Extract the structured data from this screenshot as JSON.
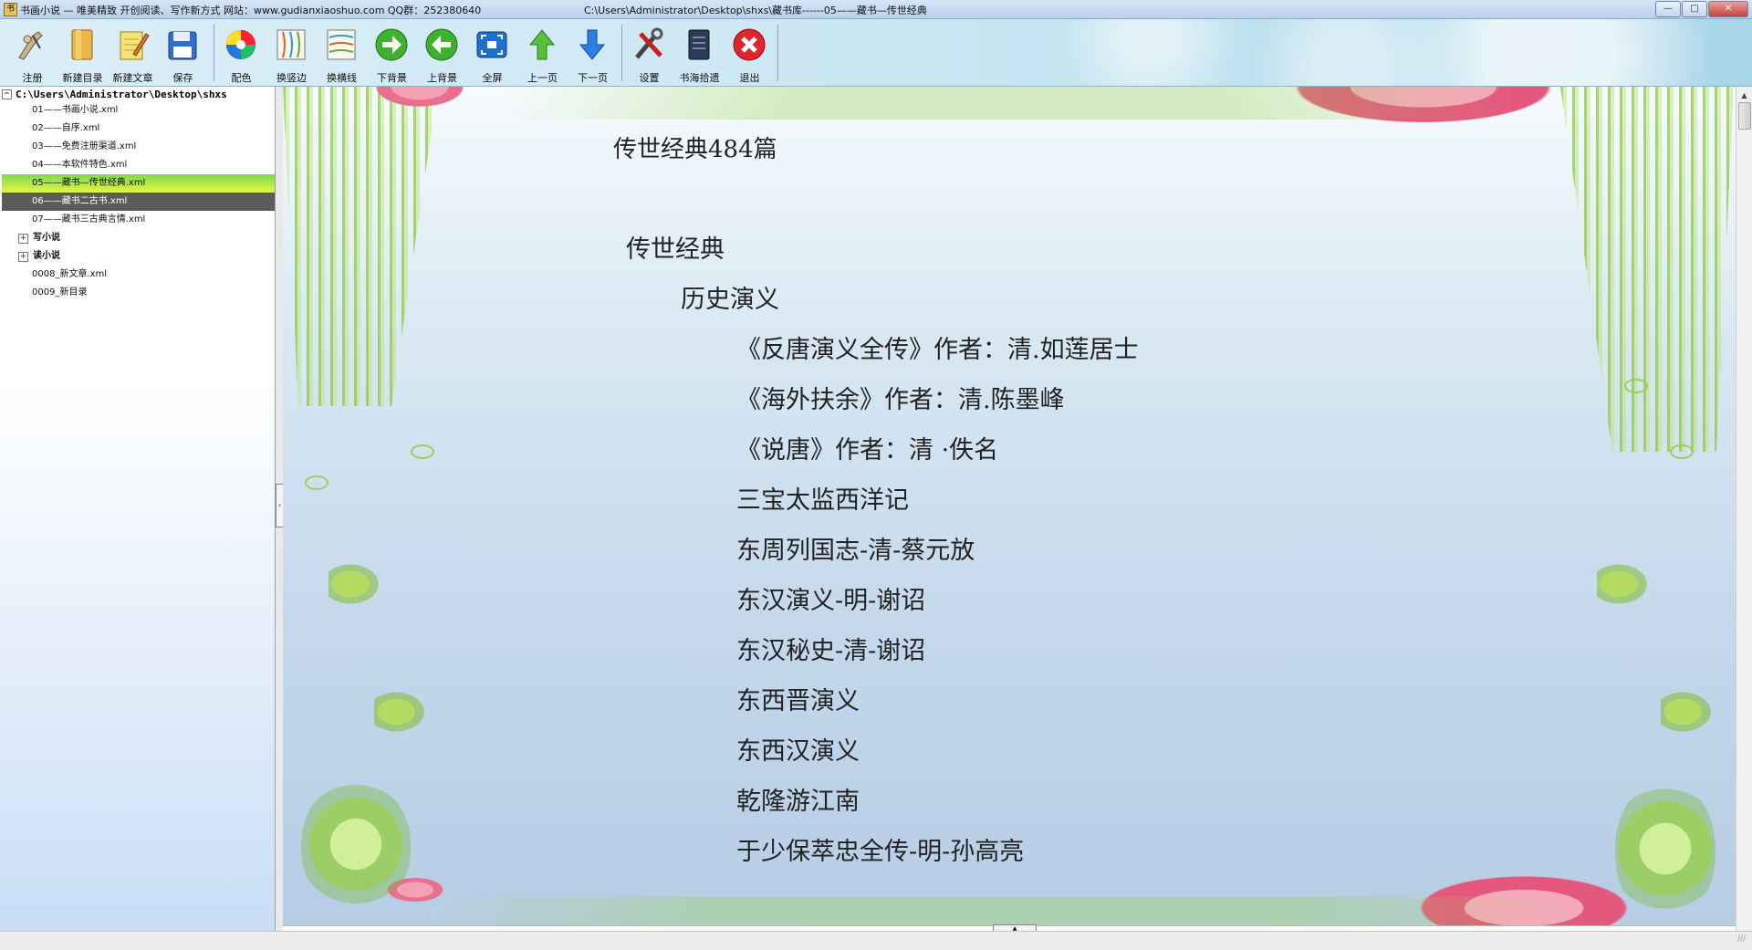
{
  "window": {
    "title": "书画小说 — 唯美精致 开创阅读、写作新方式 网站：www.gudianxiaoshuo.com QQ群：252380640",
    "path": "C:\\Users\\Administrator\\Desktop\\shxs\\藏书库------05——藏书—传世经典",
    "app_icon_glyph": "书",
    "controls": {
      "minimize": "—",
      "maximize": "□",
      "close": "✕"
    }
  },
  "toolbar": {
    "register": "注册",
    "new_folder": "新建目录",
    "new_article": "新建文章",
    "save": "保存",
    "color": "配色",
    "change_border": "换竖边",
    "change_line": "换横线",
    "next_background": "下背景",
    "prev_background": "上背景",
    "fullscreen": "全屏",
    "prev_page": "上一页",
    "next_page": "下一页",
    "settings": "设置",
    "bookmark": "书海拾遗",
    "exit": "退出"
  },
  "tree": {
    "root": "C:\\Users\\Administrator\\Desktop\\shxs",
    "items": [
      {
        "label": "01——书画小说.xml"
      },
      {
        "label": "02——自序.xml"
      },
      {
        "label": "03——免费注册渠道.xml"
      },
      {
        "label": "04——本软件特色.xml"
      },
      {
        "label": "05——藏书—传世经典.xml"
      },
      {
        "label": "06——藏书二古书.xml"
      },
      {
        "label": "07——藏书三古典言情.xml"
      },
      {
        "label": "写小说"
      },
      {
        "label": "读小说"
      },
      {
        "label": "0008_新文章.xml"
      },
      {
        "label": "0009_新目录"
      }
    ],
    "expander_collapsed": "+",
    "expander_expanded": "−"
  },
  "document": {
    "title": "传世经典484篇",
    "heading1": "传世经典",
    "heading2": "历史演义",
    "lines": [
      "《反唐演义全传》作者：清.如莲居士",
      "《海外扶余》作者：清.陈墨峰",
      "《说唐》作者：清 ·佚名",
      "三宝太监西洋记",
      "东周列国志-清-蔡元放",
      "东汉演义-明-谢诏",
      "东汉秘史-清-谢诏",
      "东西晋演义",
      "东西汉演义",
      "乾隆游江南",
      "于少保萃忠全传-明-孙高亮"
    ]
  },
  "colors": {
    "selected_item_gradient": [
      "#7dd94f",
      "#e6f540"
    ],
    "hover_item_bg": "#5b5b5b",
    "next_arrow_green": "#3fb12e",
    "exit_red": "#e0262a",
    "text": "#222222"
  },
  "icons": {
    "register": "pen-figure-icon",
    "new_folder": "folder-icon",
    "new_article": "notepad-pencil-icon",
    "save": "floppy-disk-icon",
    "color": "color-wheel-icon",
    "change_border": "vertical-border-icon",
    "change_line": "horizontal-lines-icon",
    "next_background": "green-right-arrow-icon",
    "prev_background": "green-left-arrow-icon",
    "fullscreen": "fullscreen-icon",
    "prev_page": "up-arrow-icon",
    "next_page": "down-arrow-icon",
    "settings": "tools-icon",
    "bookmark": "book-icon",
    "exit": "red-x-icon"
  }
}
